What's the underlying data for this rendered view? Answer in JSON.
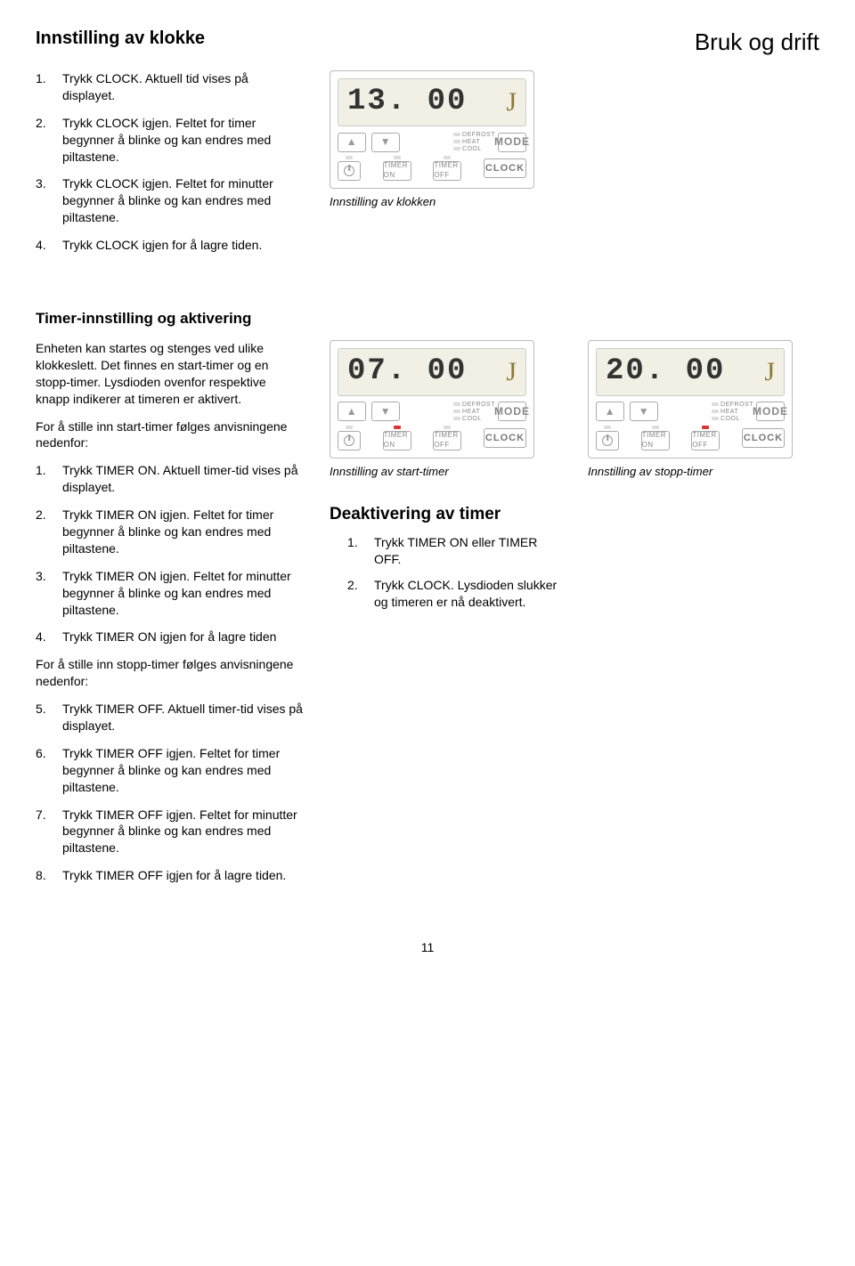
{
  "page_category": "Bruk og drift",
  "section_clock": {
    "title": "Innstilling av klokke",
    "steps": [
      "Trykk CLOCK. Aktuell tid vises på displayet.",
      "Trykk CLOCK igjen. Feltet for timer begynner å blinke og kan endres med piltastene.",
      "Trykk CLOCK igjen. Feltet for minutter begynner å blinke og kan endres med piltastene.",
      "Trykk CLOCK igjen for å lagre tiden."
    ],
    "panel_caption": "Innstilling av klokken"
  },
  "section_timer": {
    "title": "Timer-innstilling og aktivering",
    "intro": "Enheten kan startes og stenges ved ulike klokkeslett. Det finnes en start-timer og en stopp-timer. Lysdioden ovenfor respektive knapp indikerer at timeren er aktivert.",
    "intro_start": "For å stille inn start-timer følges anvisningene nedenfor:",
    "steps_start": [
      "Trykk TIMER ON. Aktuell timer-tid vises på displayet.",
      "Trykk TIMER ON igjen. Feltet for timer begynner å blinke og kan endres med piltastene.",
      "Trykk TIMER ON igjen. Feltet for minutter begynner å blinke og kan endres med piltastene.",
      "Trykk TIMER ON igjen for å lagre tiden"
    ],
    "intro_stop": "For å stille inn stopp-timer følges anvisningene nedenfor:",
    "steps_stop": [
      "Trykk TIMER OFF. Aktuell timer-tid vises på displayet.",
      "Trykk TIMER OFF igjen. Feltet for timer begynner å blinke og kan endres med piltastene.",
      "Trykk TIMER OFF igjen. Feltet for minutter begynner å blinke og kan endres med piltastene.",
      "Trykk TIMER OFF igjen for å lagre tiden."
    ],
    "panel_start_caption": "Innstilling av start-timer",
    "panel_stop_caption": "Innstilling av stopp-timer"
  },
  "section_deactivate": {
    "title": "Deaktivering av timer",
    "steps": [
      "Trykk TIMER ON eller TIMER OFF.",
      "Trykk CLOCK. Lysdioden slukker og timeren er nå deaktivert."
    ]
  },
  "panel": {
    "logo": "J",
    "mode_defrost": "DEFROST",
    "mode_heat": "HEAT",
    "mode_cool": "COOL",
    "mode_label": "MODE",
    "timer_on": "TIMER ON",
    "timer_off": "TIMER OFF",
    "clock": "CLOCK",
    "display_clock": "13. 00",
    "display_start": "07. 00",
    "display_stop": "20. 00"
  },
  "page_number": "11"
}
